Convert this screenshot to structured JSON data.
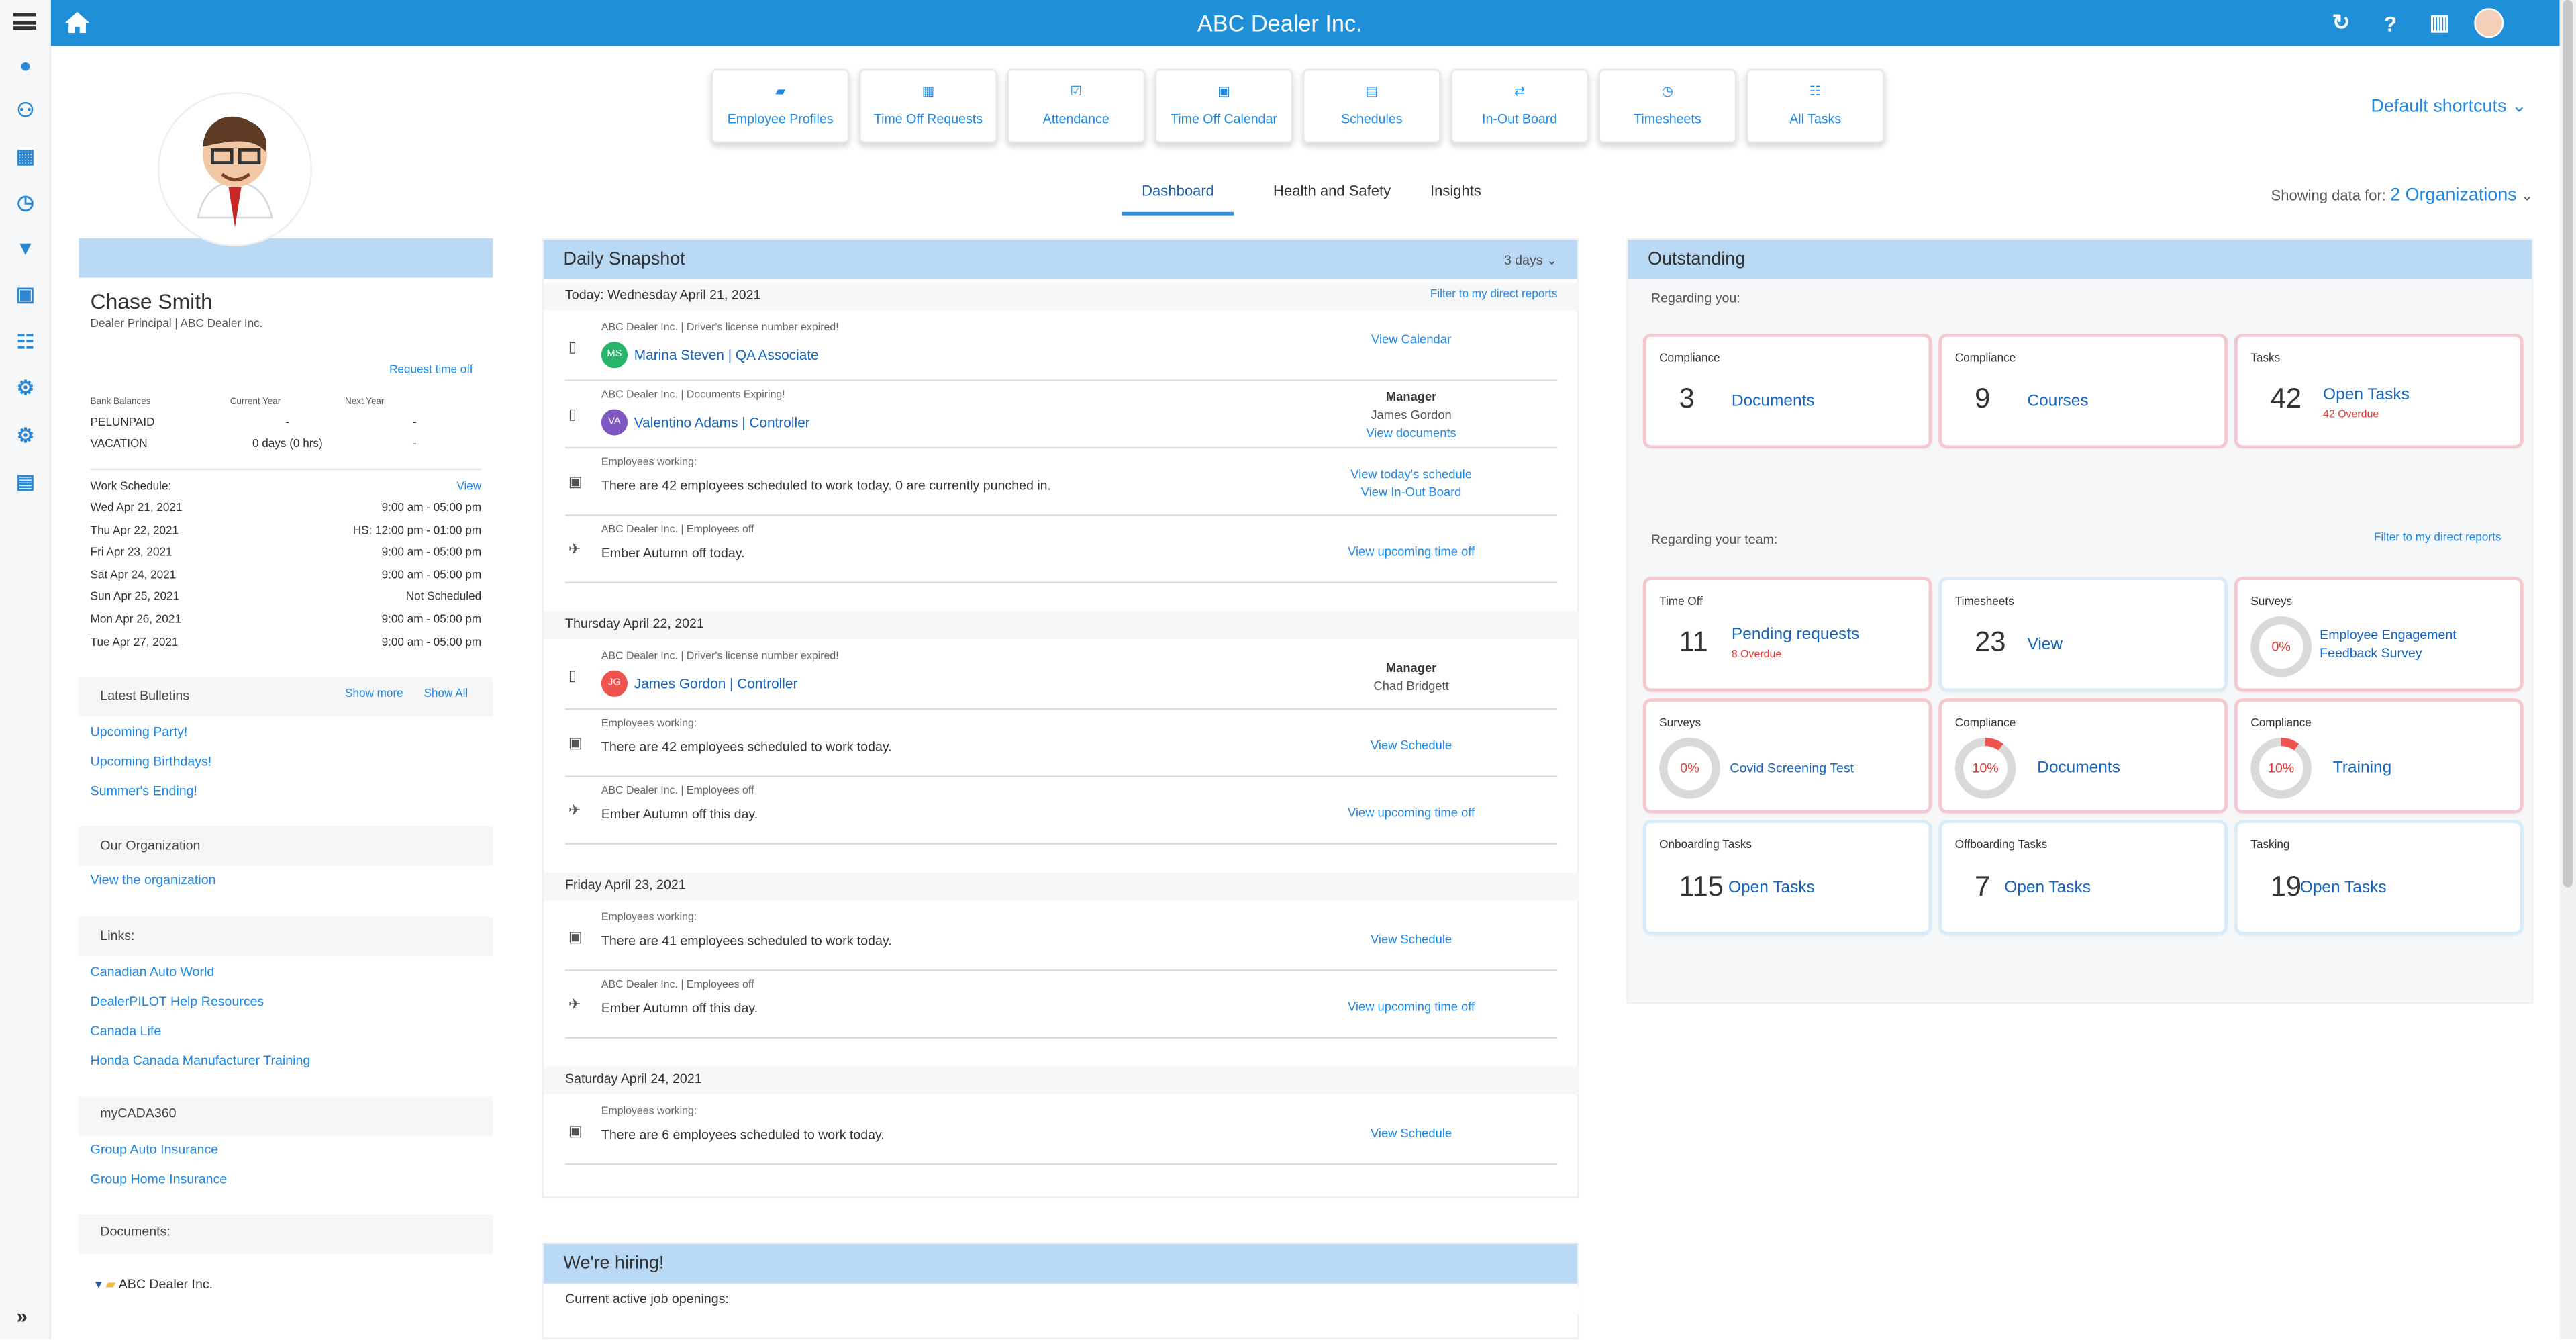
{
  "app": {
    "title": "ABC Dealer Inc."
  },
  "top_icons": [
    "refresh-icon",
    "help-icon",
    "building-icon",
    "user-avatar"
  ],
  "sidebar": {
    "items": [
      "home-icon",
      "person-icon",
      "handshake-icon",
      "dashboard-icon",
      "clock-icon",
      "filter-icon",
      "calendar-icon",
      "tasks-icon",
      "network-icon",
      "settings-icon",
      "document-icon"
    ],
    "expand_label": "»"
  },
  "shortcuts": [
    {
      "label": "Employee Profiles",
      "icon": "employee-profiles-icon"
    },
    {
      "label": "Time Off Requests",
      "icon": "calendar-plus-icon"
    },
    {
      "label": "Attendance",
      "icon": "attendance-icon"
    },
    {
      "label": "Time Off Calendar",
      "icon": "calendar-icon"
    },
    {
      "label": "Schedules",
      "icon": "schedule-icon"
    },
    {
      "label": "In-Out Board",
      "icon": "arrows-icon"
    },
    {
      "label": "Timesheets",
      "icon": "clock-icon"
    },
    {
      "label": "All Tasks",
      "icon": "task-list-icon"
    }
  ],
  "default_shortcuts": "Default shortcuts",
  "tabs": [
    "Dashboard",
    "Health and Safety",
    "Insights"
  ],
  "showing": {
    "label": "Showing data for:",
    "value": "2 Organizations"
  },
  "profile": {
    "name": "Chase Smith",
    "role": "Dealer Principal | ABC Dealer Inc.",
    "request": "Request time off",
    "bank": {
      "headers": [
        "Bank Balances",
        "Current Year",
        "Next Year"
      ],
      "rows": [
        [
          "PELUNPAID",
          "-",
          "-"
        ],
        [
          "VACATION",
          "0 days (0 hrs)",
          "-"
        ]
      ]
    },
    "schedule": {
      "title": "Work Schedule:",
      "view": "View",
      "rows": [
        [
          "Wed Apr 21, 2021",
          "9:00 am - 05:00 pm"
        ],
        [
          "Thu Apr 22, 2021",
          "HS: 12:00 pm - 01:00 pm"
        ],
        [
          "Fri Apr 23, 2021",
          "9:00 am - 05:00 pm"
        ],
        [
          "Sat Apr 24, 2021",
          "9:00 am - 05:00 pm"
        ],
        [
          "Sun Apr 25, 2021",
          "Not Scheduled"
        ],
        [
          "Mon Apr 26, 2021",
          "9:00 am - 05:00 pm"
        ],
        [
          "Tue Apr 27, 2021",
          "9:00 am - 05:00 pm"
        ]
      ]
    },
    "bulletins": {
      "title": "Latest Bulletins",
      "show_more": "Show more",
      "show_all": "Show All",
      "items": [
        "Upcoming Party!",
        "Upcoming Birthdays!",
        "Summer's Ending!"
      ]
    },
    "organization": {
      "title": "Our Organization",
      "link": "View the organization"
    },
    "links": {
      "title": "Links:",
      "items": [
        "Canadian Auto World",
        "DealerPILOT Help Resources",
        "Canada Life",
        "Honda Canada Manufacturer Training"
      ]
    },
    "cada": {
      "title": "myCADA360",
      "items": [
        "Group Auto Insurance",
        "Group Home Insurance"
      ]
    },
    "documents": {
      "title": "Documents:",
      "folder": "ABC Dealer Inc."
    }
  },
  "daily": {
    "title": "Daily Snapshot",
    "days": "3 days",
    "today": "Today: Wednesday April 21, 2021",
    "filter": "Filter to my direct reports",
    "items": [
      {
        "meta": "ABC Dealer Inc. | Driver's license number expired!",
        "person": "Marina Steven | QA Associate",
        "badge": "MS",
        "badge_color": "#28b46a",
        "action": "View Calendar"
      },
      {
        "meta": "ABC Dealer Inc. | Documents Expiring!",
        "person": "Valentino Adams | Controller",
        "badge": "VA",
        "badge_color": "#7e57c2",
        "manager": "Manager",
        "manager_name": "James Gordon",
        "action": "View documents"
      },
      {
        "meta": "Employees working:",
        "message": "There are 42 employees scheduled to work today. 0 are currently punched in.",
        "action": "View today's schedule",
        "action2": "View In-Out Board"
      },
      {
        "meta": "ABC Dealer Inc. | Employees off",
        "message": "Ember Autumn off today.",
        "action": "View upcoming time off"
      }
    ],
    "thursday": "Thursday April 22, 2021",
    "thursday_items": [
      {
        "meta": "ABC Dealer Inc. | Driver's license number expired!",
        "person": "James Gordon | Controller",
        "badge": "JG",
        "badge_color": "#ef5350",
        "manager": "Manager",
        "manager_name": "Chad Bridgett"
      },
      {
        "meta": "Employees working:",
        "message": "There are 42 employees scheduled to work today.",
        "action": "View Schedule"
      },
      {
        "meta": "ABC Dealer Inc. | Employees off",
        "message": "Ember Autumn off this day.",
        "action": "View upcoming time off"
      }
    ],
    "friday": "Friday April 23, 2021",
    "friday_items": [
      {
        "meta": "Employees working:",
        "message": "There are 41 employees scheduled to work today.",
        "action": "View Schedule"
      },
      {
        "meta": "ABC Dealer Inc. | Employees off",
        "message": "Ember Autumn off this day.",
        "action": "View upcoming time off"
      }
    ],
    "saturday": "Saturday April 24, 2021",
    "saturday_items": [
      {
        "meta": "Employees working:",
        "message": "There are 6 employees scheduled to work today.",
        "action": "View Schedule"
      }
    ]
  },
  "hiring": {
    "title": "We're hiring!",
    "subtitle": "Current active job openings:"
  },
  "outstanding": {
    "title": "Outstanding",
    "regarding_you": "Regarding you:",
    "regarding_team": "Regarding your team:",
    "filter": "Filter to my direct reports",
    "you_cards": [
      {
        "title": "Compliance",
        "number": "3",
        "link": "Documents"
      },
      {
        "title": "Compliance",
        "number": "9",
        "link": "Courses"
      },
      {
        "title": "Tasks",
        "number": "42",
        "link": "Open Tasks",
        "overdue": "42 Overdue"
      }
    ],
    "team_cards": [
      {
        "title": "Time Off",
        "number": "11",
        "link": "Pending requests",
        "overdue": "8 Overdue"
      },
      {
        "title": "Timesheets",
        "number": "23",
        "link": "View"
      },
      {
        "title": "Surveys",
        "percent": "0%",
        "percent_value": 0,
        "link": "Employee Engagement Feedback Survey"
      },
      {
        "title": "Surveys",
        "percent": "0%",
        "percent_value": 0,
        "link": "Covid Screening Test"
      },
      {
        "title": "Compliance",
        "percent": "10%",
        "percent_value": 10,
        "link": "Documents"
      },
      {
        "title": "Compliance",
        "percent": "10%",
        "percent_value": 10,
        "link": "Training"
      },
      {
        "title": "Onboarding Tasks",
        "number": "115",
        "link": "Open Tasks"
      },
      {
        "title": "Offboarding Tasks",
        "number": "7",
        "link": "Open Tasks"
      },
      {
        "title": "Tasking",
        "number": "19",
        "link": "Open Tasks"
      }
    ]
  },
  "colors": {
    "accent": "#1e88e5",
    "header": "#1f8fd8",
    "panel_head": "#b9d9f5",
    "alert": "#e53935"
  }
}
